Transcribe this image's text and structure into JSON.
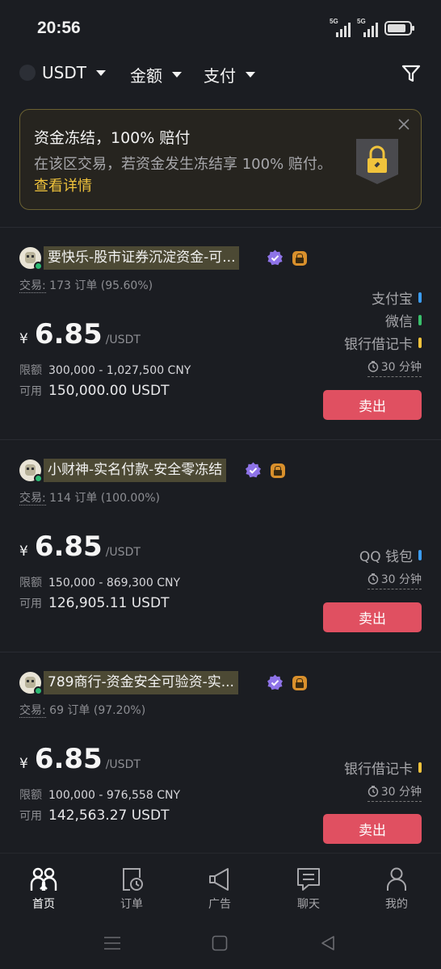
{
  "status_bar": {
    "time": "20:56",
    "network_1": "5G",
    "network_2": "5G"
  },
  "filters": {
    "coin": "USDT",
    "amount": "金额",
    "payment": "支付"
  },
  "banner": {
    "title": "资金冻结，100% 赔付",
    "text": "在该区交易，若资金发生冻结享 100% 赔付。",
    "link": "查看详情"
  },
  "listings": [
    {
      "merchant": "要快乐-股市证券沉淀资金-可...",
      "trades_label": "交易:",
      "trades": "173 订单 (95.60%)",
      "currency_symbol": "¥",
      "price": "6.85",
      "price_unit": "/USDT",
      "limit_label": "限额",
      "limit": "300,000 - 1,027,500 CNY",
      "available_label": "可用",
      "available": "150,000.00 USDT",
      "payments": [
        {
          "name": "支付宝",
          "color": "#3b9cf0"
        },
        {
          "name": "微信",
          "color": "#39c06b"
        },
        {
          "name": "银行借记卡",
          "color": "#f0c33c"
        }
      ],
      "time_limit": "30 分钟",
      "sell_label": "卖出"
    },
    {
      "merchant": "小财神-实名付款-安全零冻结",
      "trades_label": "交易:",
      "trades": "114 订单 (100.00%)",
      "currency_symbol": "¥",
      "price": "6.85",
      "price_unit": "/USDT",
      "limit_label": "限额",
      "limit": "150,000 - 869,300 CNY",
      "available_label": "可用",
      "available": "126,905.11 USDT",
      "payments": [
        {
          "name": "QQ 钱包",
          "color": "#3b9cf0"
        }
      ],
      "time_limit": "30 分钟",
      "sell_label": "卖出"
    },
    {
      "merchant": "789商行-资金安全可验资-实...",
      "trades_label": "交易:",
      "trades": "69 订单 (97.20%)",
      "currency_symbol": "¥",
      "price": "6.85",
      "price_unit": "/USDT",
      "limit_label": "限额",
      "limit": "100,000 - 976,558 CNY",
      "available_label": "可用",
      "available": "142,563.27 USDT",
      "payments": [
        {
          "name": "银行借记卡",
          "color": "#f0c33c"
        }
      ],
      "time_limit": "30 分钟",
      "sell_label": "卖出"
    }
  ],
  "bottom_nav": {
    "items": [
      {
        "label": "首页",
        "icon": "home-users-icon",
        "active": true
      },
      {
        "label": "订单",
        "icon": "order-clock-icon",
        "active": false
      },
      {
        "label": "广告",
        "icon": "megaphone-icon",
        "active": false
      },
      {
        "label": "聊天",
        "icon": "chat-icon",
        "active": false
      },
      {
        "label": "我的",
        "icon": "profile-icon",
        "active": false
      }
    ]
  },
  "system_nav": {
    "icons": [
      "menu-icon",
      "home-square-icon",
      "back-triangle-icon"
    ]
  }
}
